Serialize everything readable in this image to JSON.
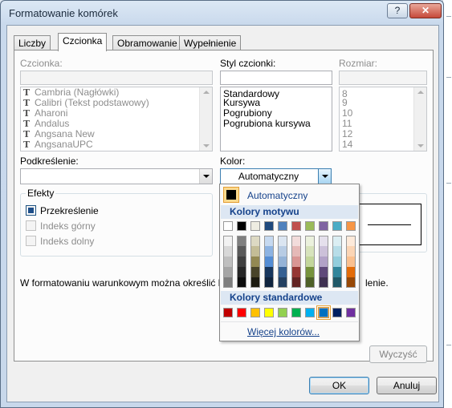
{
  "dialog": {
    "title": "Formatowanie komórek",
    "help_label": "?",
    "close_label": "✕"
  },
  "tabs": [
    {
      "label": "Liczby"
    },
    {
      "label": "Czcionka"
    },
    {
      "label": "Obramowanie"
    },
    {
      "label": "Wypełnienie"
    }
  ],
  "font": {
    "label": "Czcionka:",
    "value": "",
    "items": [
      "Cambria (Nagłówki)",
      "Calibri (Tekst podstawowy)",
      "Aharoni",
      "Andalus",
      "Angsana New",
      "AngsanaUPC"
    ]
  },
  "style": {
    "label": "Styl czcionki:",
    "value": "",
    "items": [
      "Standardowy",
      "Kursywa",
      "Pogrubiony",
      "Pogrubiona kursywa"
    ]
  },
  "size": {
    "label": "Rozmiar:",
    "value": "",
    "items": [
      "8",
      "9",
      "10",
      "11",
      "12",
      "14"
    ]
  },
  "underline": {
    "label": "Podkreślenie:",
    "value": ""
  },
  "color": {
    "label": "Kolor:",
    "value": "Automatyczny"
  },
  "effects": {
    "label": "Efekty",
    "strike": {
      "label": "Przekreślenie",
      "checked": true
    },
    "superscript": {
      "label": "Indeks górny",
      "checked": false
    },
    "subscript": {
      "label": "Indeks dolny",
      "checked": false
    }
  },
  "info_text_left": "W formatowaniu warunkowym można określić krój cz",
  "info_text_right": "lenie.",
  "buttons": {
    "clear": "Wyczyść",
    "ok": "OK",
    "cancel": "Anuluj"
  },
  "color_popup": {
    "automatic_label": "Automatyczny",
    "theme_header": "Kolory motywu",
    "standard_header": "Kolory standardowe",
    "more_label": "Więcej kolorów...",
    "theme_top_row": [
      "#ffffff",
      "#000000",
      "#eeece1",
      "#1f497d",
      "#4f81bd",
      "#c0504d",
      "#9bbb59",
      "#8064a2",
      "#4bacc6",
      "#f79646"
    ],
    "theme_shades": [
      [
        "#f2f2f2",
        "#7f7f7f",
        "#ddd9c3",
        "#c6d9f0",
        "#dbe5f1",
        "#f2dcdb",
        "#ebf1dd",
        "#e5e0ec",
        "#dbeef3",
        "#fdeada"
      ],
      [
        "#d8d8d8",
        "#595959",
        "#c4bd97",
        "#8db3e2",
        "#b8cce4",
        "#e5b9b7",
        "#d7e3bc",
        "#ccc1d9",
        "#b7dde8",
        "#fbd5b5"
      ],
      [
        "#bfbfbf",
        "#3f3f3f",
        "#938953",
        "#548dd4",
        "#95b3d7",
        "#d99694",
        "#c3d69b",
        "#b2a2c7",
        "#92cddc",
        "#fac08f"
      ],
      [
        "#a5a5a5",
        "#262626",
        "#494429",
        "#17365d",
        "#366092",
        "#953734",
        "#76923c",
        "#5f497a",
        "#31859b",
        "#e36c09"
      ],
      [
        "#7f7f7f",
        "#0c0c0c",
        "#1d1b10",
        "#0f243e",
        "#244061",
        "#632423",
        "#4f6128",
        "#3f3151",
        "#205867",
        "#974806"
      ]
    ],
    "standard_colors": [
      "#c00000",
      "#ff0000",
      "#ffc000",
      "#ffff00",
      "#92d050",
      "#00b050",
      "#00b0f0",
      "#0070c0",
      "#002060",
      "#7030a0"
    ],
    "selected_standard_index": 7
  }
}
